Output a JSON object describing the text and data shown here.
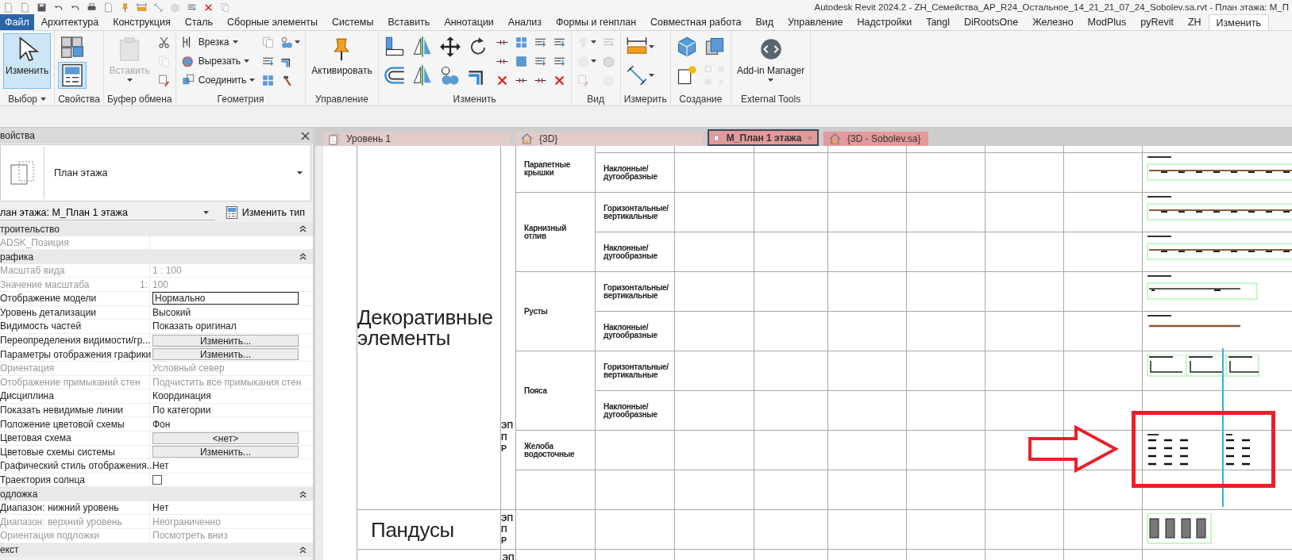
{
  "window": {
    "title": "Autodesk Revit 2024.2 - ZH_Семейства_АР_R24_Остальное_14_21_21_07_24_Sobolev.sa.rvt - План этажа: М_П"
  },
  "menu_tabs": [
    {
      "label": "Файл",
      "kind": "file",
      "selected": false
    },
    {
      "label": "Архитектура",
      "kind": "tab",
      "selected": false
    },
    {
      "label": "Конструкция",
      "kind": "tab",
      "selected": false
    },
    {
      "label": "Сталь",
      "kind": "tab",
      "selected": false
    },
    {
      "label": "Сборные элементы",
      "kind": "tab",
      "selected": false
    },
    {
      "label": "Системы",
      "kind": "tab",
      "selected": false
    },
    {
      "label": "Вставить",
      "kind": "tab",
      "selected": false
    },
    {
      "label": "Аннотации",
      "kind": "tab",
      "selected": false
    },
    {
      "label": "Анализ",
      "kind": "tab",
      "selected": false
    },
    {
      "label": "Формы и генплан",
      "kind": "tab",
      "selected": false
    },
    {
      "label": "Совместная работа",
      "kind": "tab",
      "selected": false
    },
    {
      "label": "Вид",
      "kind": "tab",
      "selected": false
    },
    {
      "label": "Управление",
      "kind": "tab",
      "selected": false
    },
    {
      "label": "Надстройки",
      "kind": "tab",
      "selected": false
    },
    {
      "label": "Tangl",
      "kind": "tab",
      "selected": false
    },
    {
      "label": "DiRootsOne",
      "kind": "tab",
      "selected": false
    },
    {
      "label": "Железно",
      "kind": "tab",
      "selected": false
    },
    {
      "label": "ModPlus",
      "kind": "tab",
      "selected": false
    },
    {
      "label": "pyRevit",
      "kind": "tab",
      "selected": false
    },
    {
      "label": "ZH",
      "kind": "tab",
      "selected": false
    },
    {
      "label": "Изменить",
      "kind": "tab",
      "selected": true
    }
  ],
  "ribbon_panels": [
    {
      "label": "Выбор",
      "menu": true,
      "items": [
        {
          "kind": "large",
          "label": "Изменить",
          "selected": true,
          "disabled": false,
          "dropdown": false
        }
      ]
    },
    {
      "label": "Свойства",
      "menu": false,
      "items": [
        {
          "kind": "tool-large",
          "selected": false,
          "disabled": false,
          "dropdown": false
        },
        {
          "kind": "tool-large",
          "selected": true,
          "disabled": false,
          "dropdown": false
        }
      ]
    },
    {
      "label": "Буфер обмена",
      "menu": false,
      "items": [
        {
          "kind": "large",
          "label": "Вставить",
          "disabled": true,
          "dropdown": true
        },
        {
          "kind": "tool",
          "disabled": false,
          "dropdown": false
        },
        {
          "kind": "tool",
          "disabled": true,
          "dropdown": false
        },
        {
          "kind": "tool",
          "disabled": false,
          "dropdown": false
        }
      ]
    },
    {
      "label": "Геометрия",
      "menu": false,
      "items": [
        {
          "kind": "small",
          "label": "Врезка",
          "disabled": false,
          "dropdown": true
        },
        {
          "kind": "small",
          "label": "Вырезать",
          "disabled": false,
          "dropdown": true
        },
        {
          "kind": "small",
          "label": "Соединить",
          "disabled": false,
          "dropdown": true
        },
        {
          "kind": "tool",
          "disabled": false,
          "dropdown": false
        },
        {
          "kind": "tool",
          "disabled": false,
          "dropdown": false
        },
        {
          "kind": "tool",
          "disabled": false,
          "dropdown": false
        },
        {
          "kind": "tool",
          "disabled": false,
          "dropdown": true
        },
        {
          "kind": "tool",
          "disabled": false,
          "dropdown": false
        },
        {
          "kind": "tool",
          "disabled": false,
          "dropdown": false
        }
      ]
    },
    {
      "label": "Управление",
      "menu": false,
      "items": [
        {
          "kind": "large",
          "label": "Активировать",
          "disabled": false,
          "dropdown": false
        }
      ]
    },
    {
      "label": "Изменить",
      "menu": false,
      "items": [
        {
          "kind": "tool-medium",
          "disabled": false,
          "dropdown": false
        },
        {
          "kind": "tool-medium",
          "disabled": false,
          "dropdown": false
        },
        {
          "kind": "tool-medium",
          "disabled": false,
          "dropdown": false
        },
        {
          "kind": "tool-medium",
          "disabled": false,
          "dropdown": false
        },
        {
          "kind": "tool-medium",
          "disabled": false,
          "dropdown": false
        },
        {
          "kind": "tool-medium",
          "disabled": false,
          "dropdown": false
        },
        {
          "kind": "tool-medium",
          "disabled": false,
          "dropdown": false
        },
        {
          "kind": "tool-medium",
          "disabled": false,
          "dropdown": false
        },
        {
          "kind": "tool",
          "disabled": false,
          "dropdown": false
        },
        {
          "kind": "tool",
          "disabled": false,
          "dropdown": false
        },
        {
          "kind": "tool",
          "disabled": false,
          "dropdown": false
        },
        {
          "kind": "tool",
          "disabled": false,
          "dropdown": false
        },
        {
          "kind": "tool",
          "disabled": false,
          "dropdown": false
        },
        {
          "kind": "tool",
          "disabled": false,
          "dropdown": false
        },
        {
          "kind": "tool",
          "disabled": false,
          "dropdown": false
        },
        {
          "kind": "tool",
          "disabled": false,
          "dropdown": false
        },
        {
          "kind": "tool",
          "disabled": false,
          "dropdown": false
        },
        {
          "kind": "tool",
          "disabled": false,
          "dropdown": false
        },
        {
          "kind": "tool",
          "disabled": false,
          "dropdown": false
        },
        {
          "kind": "tool",
          "disabled": false,
          "dropdown": false
        }
      ]
    },
    {
      "label": "Вид",
      "menu": false,
      "items": [
        {
          "kind": "tool",
          "disabled": true,
          "dropdown": true
        },
        {
          "kind": "tool",
          "disabled": true,
          "dropdown": true
        },
        {
          "kind": "tool",
          "disabled": true,
          "dropdown": false
        },
        {
          "kind": "tool",
          "disabled": true,
          "dropdown": false
        },
        {
          "kind": "tool",
          "disabled": false,
          "dropdown": false
        },
        {
          "kind": "tool",
          "disabled": true,
          "dropdown": false
        }
      ]
    },
    {
      "label": "Измерить",
      "menu": false,
      "items": [
        {
          "kind": "tool-medium",
          "disabled": false,
          "dropdown": true
        },
        {
          "kind": "tool-medium",
          "disabled": false,
          "dropdown": true
        }
      ]
    },
    {
      "label": "Создание",
      "menu": false,
      "items": [
        {
          "kind": "tool-medium",
          "disabled": false,
          "dropdown": false
        },
        {
          "kind": "tool-medium",
          "disabled": false,
          "dropdown": false
        },
        {
          "kind": "tool-medium",
          "disabled": false,
          "dropdown": false
        },
        {
          "kind": "tool-medium",
          "disabled": true,
          "dropdown": false
        }
      ]
    },
    {
      "label": "External Tools",
      "menu": false,
      "items": [
        {
          "kind": "large",
          "label": "Add-in Manager",
          "disabled": false,
          "dropdown": true
        }
      ]
    }
  ],
  "properties": {
    "title": "войства",
    "type_name": "План этажа",
    "instance_selector": "лан этажа: М_План 1 этажа",
    "edit_type_button": "Изменить тип",
    "sections": [
      {
        "title": "троительство",
        "expanded": true,
        "rows": [
          {
            "name": "ADSK_Позиция",
            "kind": "text",
            "disabled": true
          }
        ]
      },
      {
        "title": "рафика",
        "expanded": true,
        "rows": [
          {
            "name": "Масштаб вида",
            "value": "1 : 100",
            "kind": "text",
            "disabled": true
          },
          {
            "name": "Значение масштаба",
            "suffix": "1:",
            "value": "100",
            "kind": "text",
            "disabled": true
          },
          {
            "name": "Отображение модели",
            "value": "Нормально",
            "kind": "field",
            "disabled": false
          },
          {
            "name": "Уровень детализации",
            "value": "Высокий",
            "kind": "text",
            "disabled": false
          },
          {
            "name": "Видимость частей",
            "value": "Показать оригинал",
            "kind": "text",
            "disabled": false
          },
          {
            "name": "Переопределения видимости/гр...",
            "value": "Изменить...",
            "kind": "button",
            "disabled": false
          },
          {
            "name": "Параметры отображения графики",
            "value": "Изменить...",
            "kind": "button",
            "disabled": false
          },
          {
            "name": "Ориентация",
            "value": "Условный север",
            "kind": "text",
            "disabled": true
          },
          {
            "name": "Отображение примыканий стен",
            "value": "Подчистить все примыкания стен",
            "kind": "text",
            "disabled": true
          },
          {
            "name": "Дисциплина",
            "value": "Координация",
            "kind": "text",
            "disabled": false
          },
          {
            "name": "Показать невидимые линии",
            "value": "По категории",
            "kind": "text",
            "disabled": false
          },
          {
            "name": "Положение цветовой схемы",
            "value": "Фон",
            "kind": "text",
            "disabled": false
          },
          {
            "name": "Цветовая схема",
            "value": "<нет>",
            "kind": "button",
            "disabled": false
          },
          {
            "name": "Цветовые схемы системы",
            "value": "Изменить...",
            "kind": "button",
            "disabled": false
          },
          {
            "name": "Графический стиль отображения...",
            "value": "Нет",
            "kind": "text",
            "disabled": false
          },
          {
            "name": "Траектория солнца",
            "kind": "checkbox",
            "checked": false,
            "disabled": false
          }
        ]
      },
      {
        "title": "одложка",
        "expanded": true,
        "rows": [
          {
            "name": "Диапазон: нижний уровень",
            "value": "Нет",
            "kind": "text",
            "disabled": false
          },
          {
            "name": "Диапазон: верхний уровень",
            "value": "Неограниченно",
            "kind": "text",
            "disabled": true
          },
          {
            "name": "Ориентация подложки",
            "value": "Посмотреть вниз",
            "kind": "text",
            "disabled": true
          }
        ]
      },
      {
        "title": "екст",
        "expanded": true
      }
    ]
  },
  "view_tabs": [
    {
      "label": "Уровень 1",
      "kind": "plan",
      "color": "#e2cbcb",
      "selected": false
    },
    {
      "label": "{3D}",
      "kind": "model",
      "color": "#e2cbcb",
      "selected": false
    },
    {
      "label": "М_План 1 этажа",
      "kind": "plan",
      "color": "#e39a9a",
      "selected": true
    },
    {
      "label": "{3D - Sobolev.sa}",
      "kind": "model",
      "color": "#e39a9a",
      "selected": false
    }
  ],
  "schedule": {
    "groups": [
      {
        "title": "Декоративные элементы",
        "mark": "ЭП П Р",
        "subgroups": [
          {
            "name": "Парапетные крышки",
            "types": [
              {
                "kind": "empty"
              },
              {
                "name": "Наклонные/ дугообразные",
                "kind": "strip"
              }
            ]
          },
          {
            "name": "Карнизный отлив",
            "types": [
              {
                "name": "Горизонтальные/ вертикальные",
                "kind": "strip"
              },
              {
                "name": "Наклонные/ дугообразные",
                "kind": "strip"
              }
            ]
          },
          {
            "name": "Русты",
            "types": [
              {
                "name": "Горизонтальные/ вертикальные",
                "kind": "short"
              },
              {
                "name": "Наклонные/ дугообразные",
                "kind": "bare"
              }
            ]
          },
          {
            "name": "Пояса",
            "types": [
              {
                "name": "Горизонтальные/ вертикальные",
                "kind": "triple"
              },
              {
                "name": "Наклонные/ дугообразные",
                "kind": "empty"
              }
            ]
          },
          {
            "name": "Желоба водосточные",
            "types": [
              {
                "kind": "dashes"
              }
            ]
          },
          {
            "types": [
              {
                "kind": "empty"
              }
            ]
          }
        ]
      },
      {
        "title": "Пандусы",
        "mark": "ЭП П Р",
        "subgroups": [
          {
            "types": [
              {
                "kind": "columns"
              }
            ]
          }
        ]
      },
      {
        "mark": "ЭП",
        "subgroups": [
          {
            "types": [
              {
                "kind": "empty"
              }
            ]
          }
        ]
      }
    ]
  }
}
